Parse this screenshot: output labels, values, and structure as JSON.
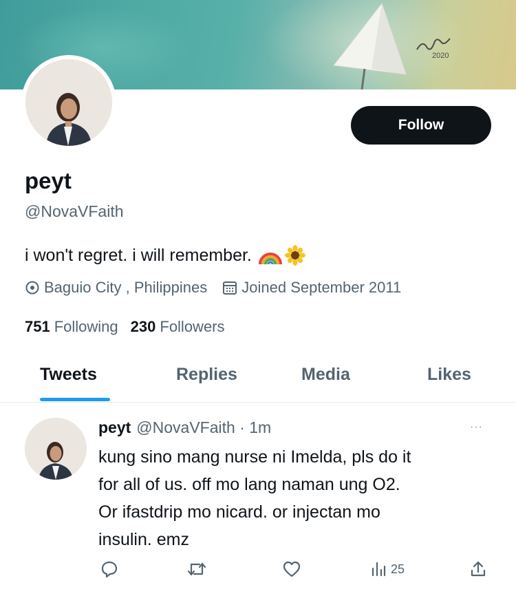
{
  "banner": {
    "signature": "2020"
  },
  "profile": {
    "name": "peyt",
    "handle": "@NovaVFaith",
    "bio": "i won't regret. i will remember.",
    "bio_emoji": [
      "rainbow",
      "sunflower"
    ],
    "location": "Baguio City , Philippines",
    "joined": "Joined September 2011",
    "following_count": "751",
    "following_label": "Following",
    "followers_count": "230",
    "followers_label": "Followers",
    "follow_label": "Follow"
  },
  "tabs": [
    {
      "label": "Tweets",
      "active": true
    },
    {
      "label": "Replies",
      "active": false
    },
    {
      "label": "Media",
      "active": false
    },
    {
      "label": "Likes",
      "active": false
    }
  ],
  "tweet": {
    "name": "peyt",
    "handle_time": "@NovaVFaith · 1m",
    "more": "···",
    "lines": [
      "kung sino mang nurse ni Imelda, pls do it",
      "for all of us. off mo lang naman ung O2.",
      "Or ifastdrip mo nicard. or injectan mo",
      "insulin. emz"
    ],
    "views": "25"
  },
  "colors": {
    "accent": "#1d9bf0",
    "text": "#0f1419",
    "muted": "#536471"
  }
}
